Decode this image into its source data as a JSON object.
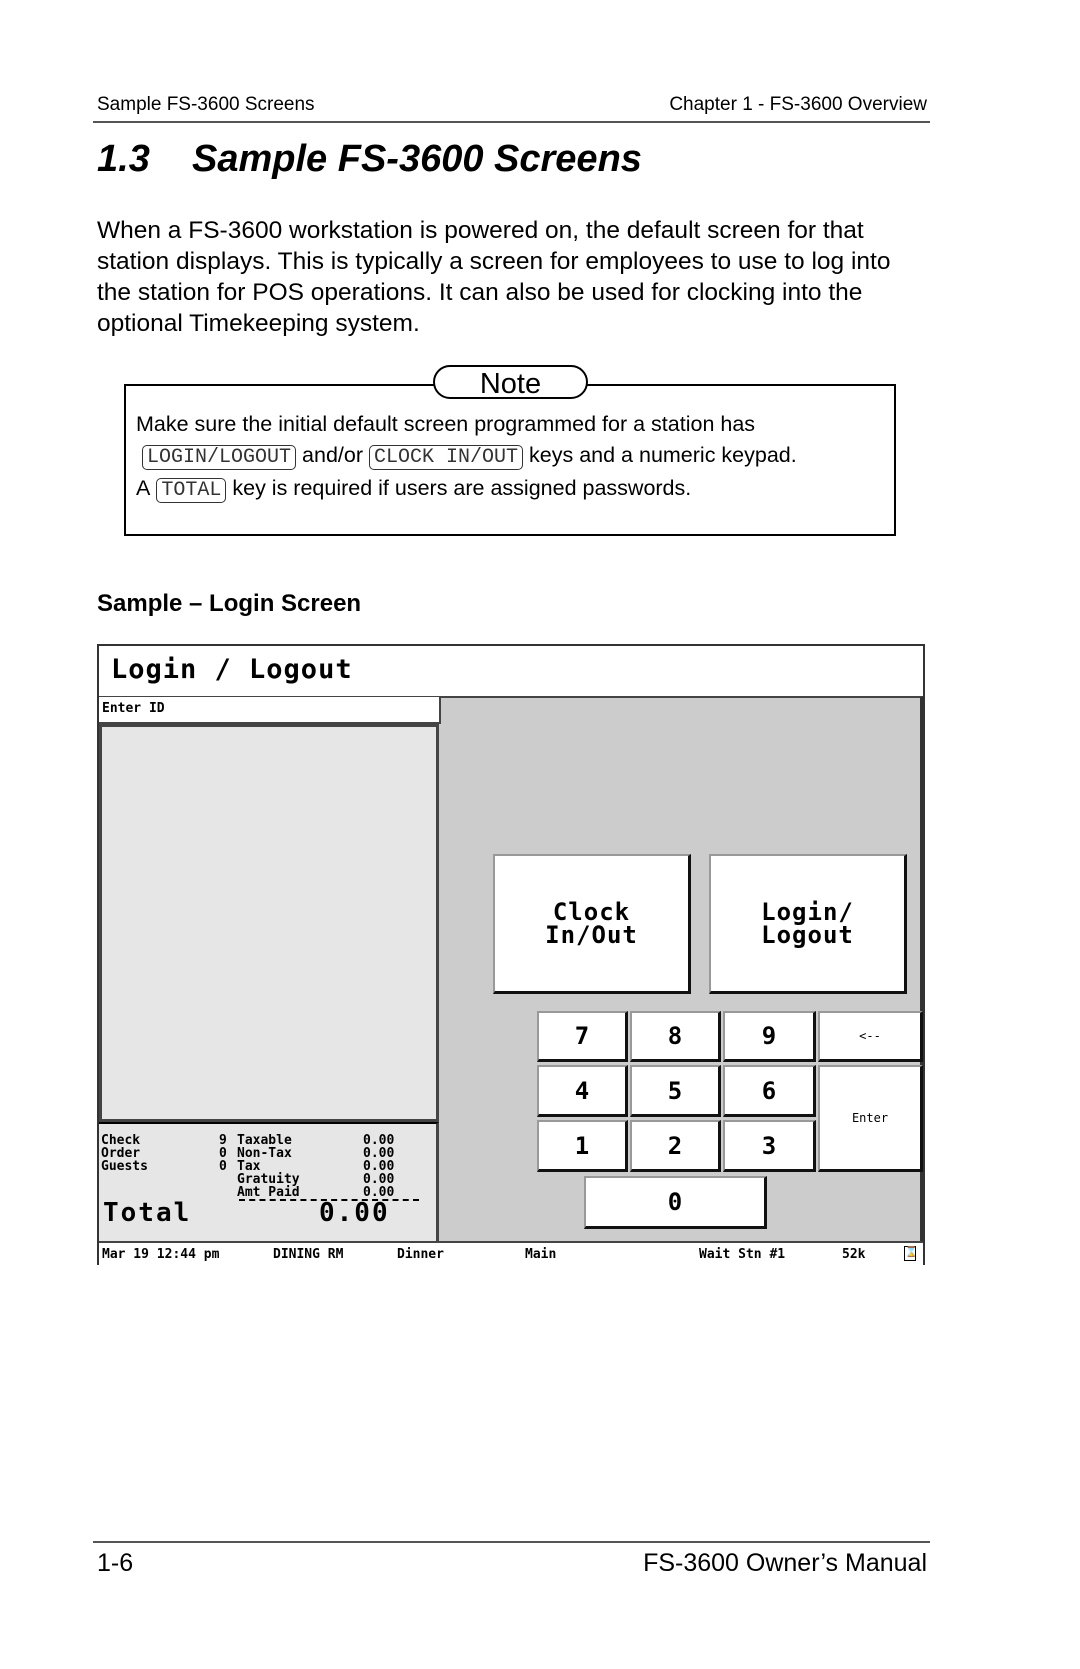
{
  "header": {
    "left": "Sample FS-3600 Screens",
    "right": "Chapter 1 - FS-3600 Overview"
  },
  "section": {
    "number": "1.3",
    "title": "Sample FS-3600 Screens"
  },
  "intro": "When a FS-3600 workstation is powered on, the default screen for that station displays.  This is typically a screen for employees to use to log into the station for POS operations.  It can also be used for clocking into the optional Timekeeping system.",
  "note": {
    "label": "Note",
    "text1": "Make sure the initial default screen programmed for a station has",
    "key1": "LOGIN/LOGOUT",
    "text2": "and/or",
    "key2": "CLOCK IN/OUT",
    "text3": "keys and a numeric keypad.  A",
    "key3": "TOTAL",
    "text4": "key is required if users are assigned passwords."
  },
  "subheading": "Sample – Login Screen",
  "screen": {
    "title": "Login / Logout",
    "prompt": "Enter ID",
    "summary": {
      "left": [
        {
          "label": "Check",
          "value": "9"
        },
        {
          "label": "Order",
          "value": "0"
        },
        {
          "label": "Guests",
          "value": "0"
        }
      ],
      "right": [
        {
          "label": "Taxable",
          "value": "0.00"
        },
        {
          "label": "Non-Tax",
          "value": "0.00"
        },
        {
          "label": "Tax",
          "value": "0.00"
        },
        {
          "label": "Gratuity",
          "value": "0.00"
        },
        {
          "label": "Amt Paid",
          "value": "0.00"
        }
      ],
      "total_label": "Total",
      "total_value": "0.00"
    },
    "buttons": {
      "clock": "Clock\nIn/Out",
      "login": "Login/\nLogout",
      "keys": [
        "7",
        "8",
        "9",
        "4",
        "5",
        "6",
        "1",
        "2",
        "3",
        "0"
      ],
      "back": "<--",
      "enter": "Enter"
    },
    "status": {
      "datetime": "Mar 19 12:44 pm",
      "area": "DINING RM",
      "meal": "Dinner",
      "menu": "Main",
      "station": "Wait Stn #1",
      "memory": "52k",
      "icon": "hourglass-icon"
    }
  },
  "footer": {
    "left": "1-6",
    "right": "FS-3600 Owner’s Manual"
  }
}
